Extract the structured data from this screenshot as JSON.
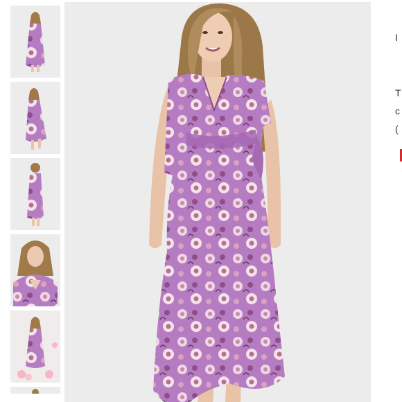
{
  "gallery": {
    "thumbnails": [
      {
        "view": "full-front"
      },
      {
        "view": "walking"
      },
      {
        "view": "back"
      },
      {
        "view": "bust-closeup"
      },
      {
        "view": "with-balloons"
      },
      {
        "view": "partial"
      }
    ],
    "main_view": "full-front",
    "favorite_icon": "heart-outline-icon"
  },
  "side_panel": {
    "fragments": [
      "I",
      "T",
      "c",
      "(",
      ""
    ]
  },
  "colors": {
    "dress": "#b77fc4",
    "background": "#ececec",
    "accent": "#d62b2b"
  }
}
